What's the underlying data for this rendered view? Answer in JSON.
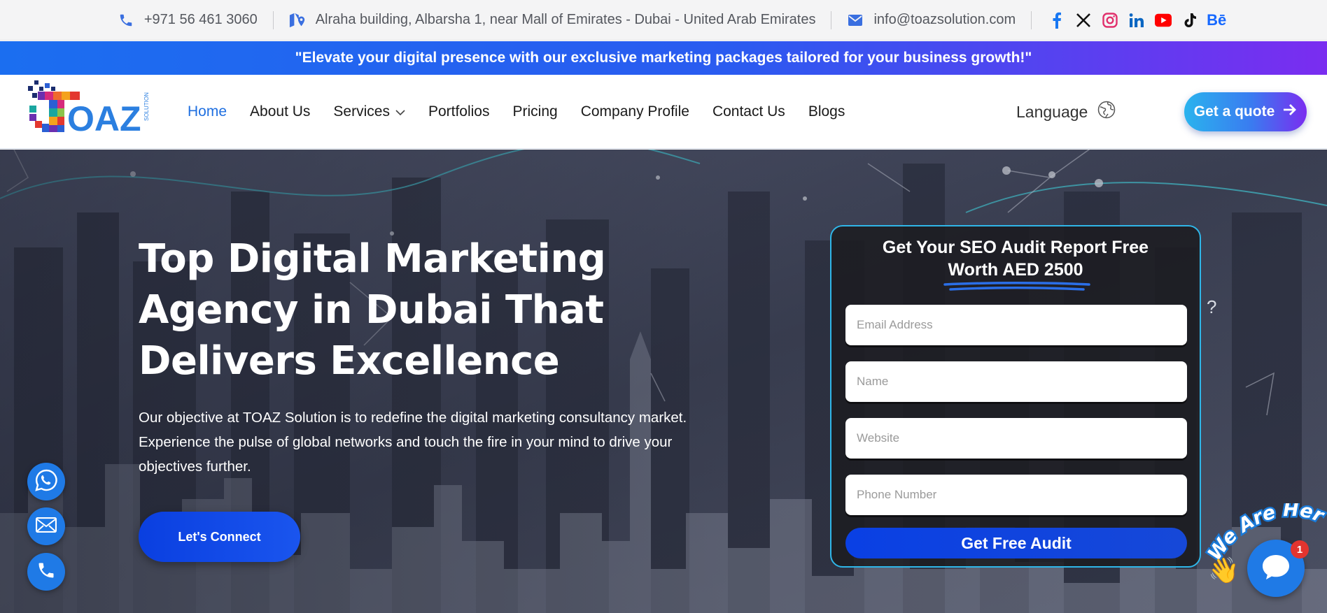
{
  "topbar": {
    "phone": "+971 56 461 3060",
    "address": "Alraha building, Albarsha 1, near Mall of Emirates - Dubai - United Arab Emirates",
    "email": "info@toazsolution.com",
    "socials": [
      {
        "icon": "facebook-icon",
        "color": "#1877f2"
      },
      {
        "icon": "x-twitter-icon",
        "color": "#111111"
      },
      {
        "icon": "instagram-icon",
        "color": "#e1306c"
      },
      {
        "icon": "linkedin-icon",
        "color": "#0a66c2"
      },
      {
        "icon": "youtube-icon",
        "color": "#ff0000"
      },
      {
        "icon": "tiktok-icon",
        "color": "#111111"
      },
      {
        "icon": "behance-icon",
        "color": "#1769ff",
        "label": "Bē"
      }
    ]
  },
  "promo": {
    "text": "\"Elevate your digital presence with our exclusive marketing packages tailored for your business growth!\""
  },
  "header": {
    "logo_text": "TOAZ",
    "logo_subtext": "SOLUTION",
    "nav": [
      {
        "label": "Home",
        "active": true
      },
      {
        "label": "About Us"
      },
      {
        "label": "Services",
        "dropdown": true
      },
      {
        "label": "Portfolios"
      },
      {
        "label": "Pricing"
      },
      {
        "label": "Company Profile"
      },
      {
        "label": "Contact Us"
      },
      {
        "label": "Blogs"
      }
    ],
    "language_label": "Language",
    "quote_button": "Get a quote"
  },
  "hero": {
    "title": "Top Digital Marketing Agency in Dubai That Delivers Excellence",
    "description": "Our objective at TOAZ Solution is to redefine the digital marketing consultancy market. Experience the pulse of global networks and touch the fire in your mind to drive your objectives further.",
    "cta": "Let's Connect"
  },
  "form": {
    "title_line1": "Get Your SEO Audit Report Free",
    "title_line2": "Worth AED 2500",
    "fields": [
      {
        "placeholder": "Email Address"
      },
      {
        "placeholder": "Name"
      },
      {
        "placeholder": "Website"
      },
      {
        "placeholder": "Phone Number"
      }
    ],
    "submit": "Get Free Audit"
  },
  "chat": {
    "banner": "We Are Here!",
    "badge_count": "1"
  },
  "colors": {
    "accent": "#1f6fe0",
    "promo_start": "#1b6ef0",
    "promo_end": "#7a2df0",
    "form_border": "#2fb6e8",
    "cta_blue": "#0a47e6"
  }
}
